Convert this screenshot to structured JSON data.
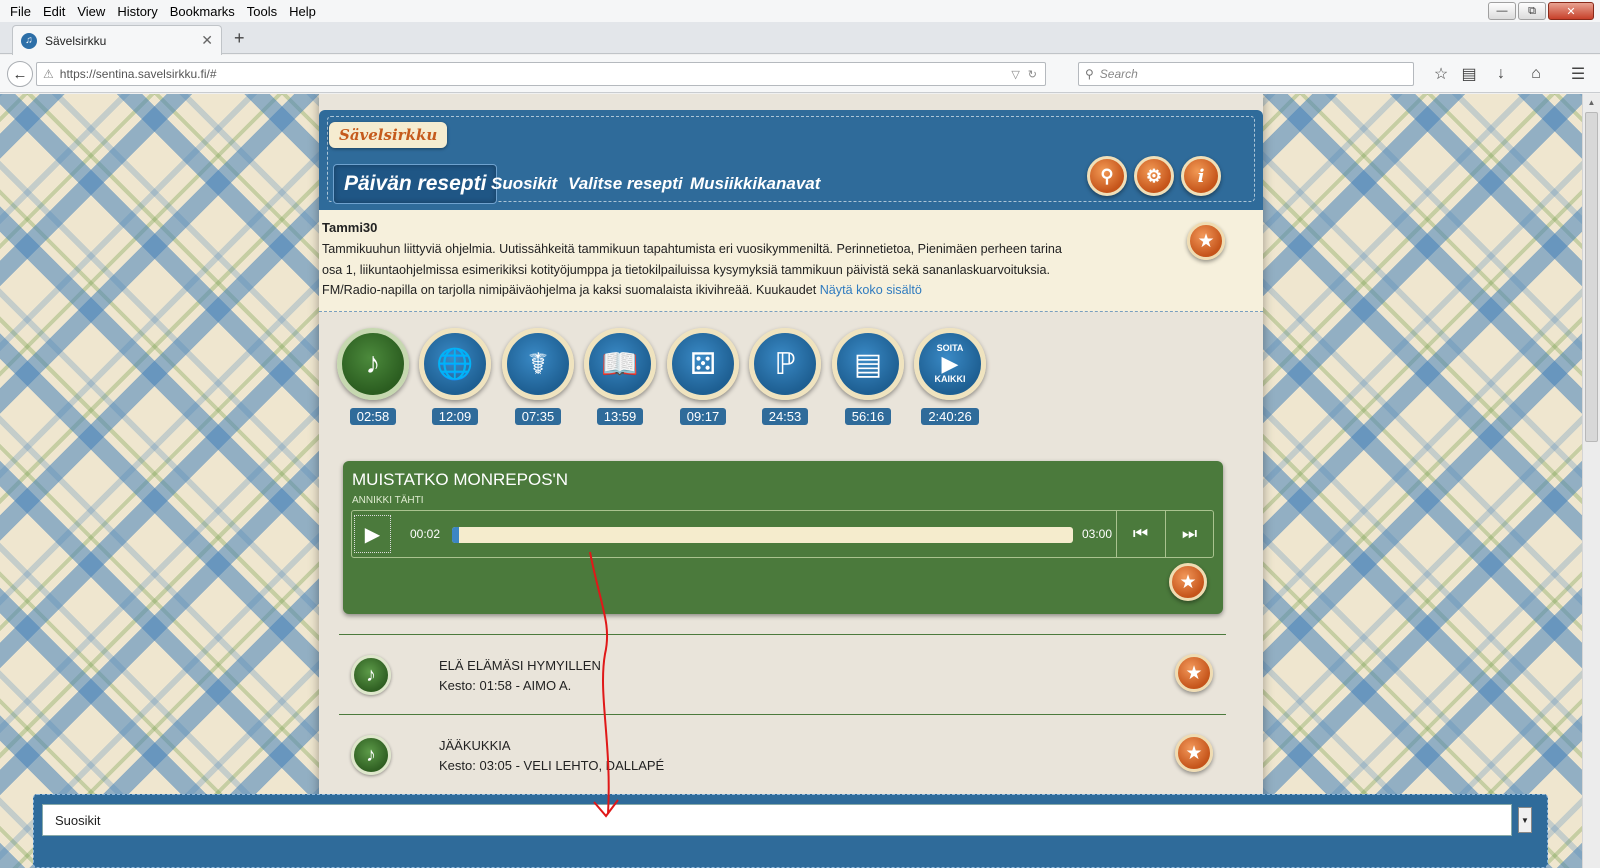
{
  "browser": {
    "menu": [
      "File",
      "Edit",
      "View",
      "History",
      "Bookmarks",
      "Tools",
      "Help"
    ],
    "tab_title": "Sävelsirkku",
    "url": "https://sentina.savelsirkku.fi/#",
    "search_placeholder": "Search"
  },
  "header": {
    "logo": "Sävelsirkku",
    "nav_active": "Päivän resepti",
    "nav": [
      "Suosikit",
      "Valitse resepti",
      "Musiikkikanavat"
    ],
    "icons": [
      "search-icon",
      "gear-icon",
      "info-icon"
    ]
  },
  "description": {
    "title": "Tammi30",
    "body": "Tammikuuhun liittyviä ohjelmia. Uutissähkeitä tammikuun tapahtumista eri vuosikymmeniltä. Perinnetietoa, Pienimäen perheen tarina osa 1, liikuntaohjelmissa esimerikiksi kotityöjumppa ja tietokilpailuissa kysymyksiä tammikuun päivistä sekä sananlaskuarvoituksia. FM/Radio-napilla on tarjolla nimipäiväohjelma ja kaksi suomalaista ikivihreää. Kuukaudet",
    "more_link": "Näytä koko sisältö"
  },
  "categories": [
    {
      "icon": "music-note-icon",
      "time": "02:58",
      "active": true
    },
    {
      "icon": "globe-icon",
      "time": "12:09"
    },
    {
      "icon": "angel-icon",
      "time": "07:35"
    },
    {
      "icon": "book-icon",
      "time": "13:59"
    },
    {
      "icon": "dice-icon",
      "time": "09:17"
    },
    {
      "icon": "exercise-icon",
      "time": "24:53"
    },
    {
      "icon": "radio-icon",
      "time": "56:16"
    },
    {
      "icon": "play-all-icon",
      "time": "2:40:26",
      "label_top": "SOITA",
      "label_bottom": "KAIKKI"
    }
  ],
  "player": {
    "title": "MUISTATKO MONREPOS'N",
    "artist": "ANNIKKI TÄHTI",
    "current_time": "00:02",
    "duration": "03:00",
    "progress_fraction": 0.011
  },
  "tracks": [
    {
      "title": "ELÄ ELÄMÄSI HYMYILLEN",
      "detail": "Kesto: 01:58 - AIMO A."
    },
    {
      "title": "JÄÄKUKKIA",
      "detail": "Kesto: 03:05 - VELI LEHTO, DALLAPÉ"
    }
  ],
  "bottom_select": {
    "selected": "Suosikit"
  }
}
